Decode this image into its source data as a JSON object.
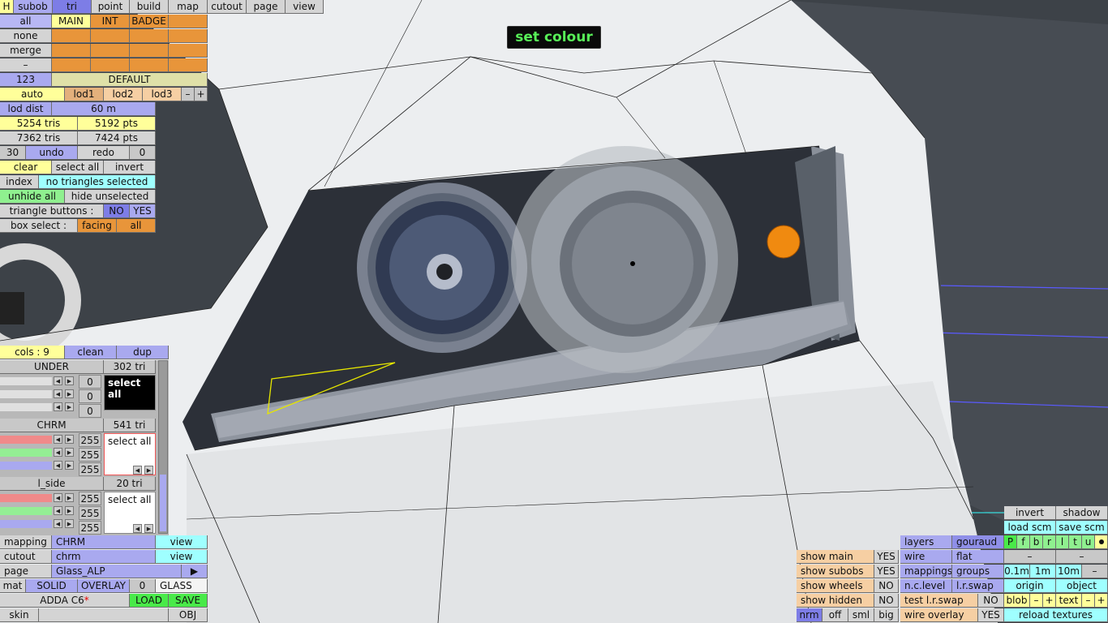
{
  "toast": "set colour",
  "top_menu": {
    "h": "H",
    "items": [
      "subob",
      "tri",
      "point",
      "build",
      "map",
      "cutout",
      "page",
      "view"
    ]
  },
  "sel_buttons": [
    "all",
    "none",
    "merge",
    "–"
  ],
  "layer_headers": [
    "MAIN",
    "INT",
    "BADGE"
  ],
  "lod": {
    "number": "123",
    "name": "DEFAULT",
    "auto": "auto",
    "lod1": "lod1",
    "lod2": "lod2",
    "lod3": "lod3",
    "minus": "–",
    "plus": "+",
    "dist_label": "lod dist",
    "dist_value": "60 m"
  },
  "stats": {
    "tris1": "5254 tris",
    "pts1": "5192 pts",
    "tris2": "7362 tris",
    "pts2": "7424 pts"
  },
  "undo": {
    "count": "30",
    "undo": "undo",
    "redo": "redo",
    "redo_count": "0"
  },
  "selection": {
    "clear": "clear",
    "select_all": "select all",
    "invert": "invert",
    "index": "index",
    "status": "no triangles selected",
    "unhide_all": "unhide all",
    "hide_unselected": "hide unselected",
    "tri_buttons": "triangle buttons :",
    "no": "NO",
    "yes": "YES",
    "box_select": "box select :",
    "facing": "facing",
    "all": "all"
  },
  "colours": {
    "cols": "cols : 9",
    "clean": "clean",
    "dup": "dup"
  },
  "materials": [
    {
      "name": "UNDER",
      "count": "302 tri",
      "values": [
        "0",
        "0",
        "0"
      ],
      "select": "select all"
    },
    {
      "name": "CHRM",
      "count": "541 tri",
      "values": [
        "255",
        "255",
        "255"
      ],
      "select": "select all"
    },
    {
      "name": "l_side",
      "count": "20 tri",
      "values": [
        "255",
        "255",
        "255"
      ],
      "select": "select all"
    }
  ],
  "bottom_left": {
    "mapping": "mapping",
    "mapping_val": "CHRM",
    "view": "view",
    "cutout": "cutout",
    "cutout_val": "chrm",
    "page": "page",
    "page_val": "Glass_ALP",
    "play": "▶",
    "mat": "mat",
    "solid": "SOLID",
    "overlay": "OVERLAY",
    "zero": "0",
    "glass": "GLASS",
    "car": "ADDA C6",
    "star": "*",
    "load": "LOAD",
    "save": "SAVE",
    "skin": "skin",
    "obj": "OBJ"
  },
  "show_panel": {
    "items": [
      {
        "label": "show main",
        "val": "YES"
      },
      {
        "label": "show subobs",
        "val": "YES"
      },
      {
        "label": "show wheels",
        "val": "NO"
      },
      {
        "label": "show hidden",
        "val": "NO"
      }
    ],
    "nrm": "nrm",
    "off": "off",
    "sml": "sml",
    "big": "big"
  },
  "render_panel": {
    "layers": "layers",
    "gouraud": "gouraud",
    "wire": "wire",
    "flat": "flat",
    "mappings": "mappings",
    "groups": "groups",
    "nclevel": "n.c.level",
    "lrswap": "l.r.swap",
    "test_lr": "test l.r.swap",
    "test_val": "NO",
    "wire_overlay": "wire overlay",
    "wire_val": "YES"
  },
  "right_panel": {
    "invert": "invert",
    "shadow": "shadow",
    "load_scm": "load scm",
    "save_scm": "save scm",
    "letters": [
      "P",
      "f",
      "b",
      "r",
      "l",
      "t",
      "u"
    ],
    "m1": "–",
    "m2": "–",
    "d1": "0.1m",
    "d2": "1m",
    "d3": "10m",
    "m3": "–",
    "origin": "origin",
    "object": "object",
    "blob": "blob",
    "text": "text",
    "minus": "–",
    "plus": "+",
    "reload": "reload textures"
  },
  "colors": {
    "blue": "#a9a9ef",
    "yellow": "#ffff9a",
    "orange": "#e8953a",
    "cyan": "#9fffff",
    "green": "#49ea49",
    "peach": "#f6cfa3"
  }
}
